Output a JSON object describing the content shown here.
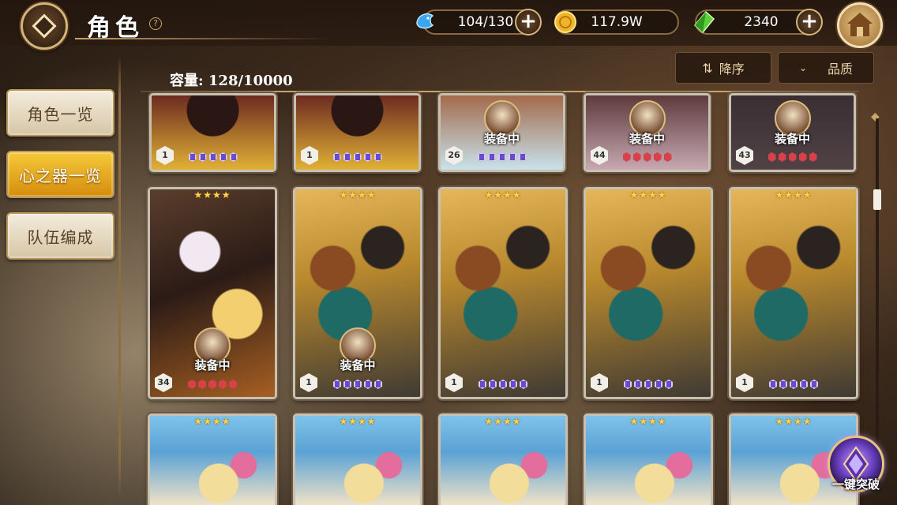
{
  "header": {
    "title": "角色",
    "help_glyph": "?",
    "stamina": "104/130",
    "gold": "117.9W",
    "gems": "2340",
    "plus_glyph": "+"
  },
  "sort": {
    "order_label": "降序",
    "quality_label": "品质"
  },
  "capacity": "容量: 128/10000",
  "tabs": [
    {
      "label": "角色一览",
      "active": false
    },
    {
      "label": "心之器一览",
      "active": true
    },
    {
      "label": "队伍编成",
      "active": false
    }
  ],
  "cards": {
    "row1": [
      {
        "level": "1",
        "equipped": false
      },
      {
        "level": "1",
        "equipped": false
      },
      {
        "level": "26",
        "equipped": true,
        "equip_label": "装备中"
      },
      {
        "level": "44",
        "equipped": true,
        "equip_label": "装备中"
      },
      {
        "level": "43",
        "equipped": true,
        "equip_label": "装备中"
      }
    ],
    "row2": [
      {
        "stars": "★★★★",
        "level": "34",
        "equipped": true,
        "equip_label": "装备中"
      },
      {
        "stars": "★★★★",
        "level": "1",
        "equipped": true,
        "equip_label": "装备中"
      },
      {
        "stars": "★★★★",
        "level": "1",
        "equipped": false
      },
      {
        "stars": "★★★★",
        "level": "1",
        "equipped": false
      },
      {
        "stars": "★★★★",
        "level": "1",
        "equipped": false
      }
    ],
    "row3": [
      {
        "stars": "★★★★"
      },
      {
        "stars": "★★★★"
      },
      {
        "stars": "★★★★"
      },
      {
        "stars": "★★★★"
      },
      {
        "stars": "★★★★"
      }
    ]
  },
  "break_button": "一键突破",
  "colors": {
    "accent_gold": "#c9a56c",
    "active_tab": "#f6c93a",
    "equip_gem_purple": "#6a4bd0",
    "equip_gem_red": "#d8414a"
  }
}
